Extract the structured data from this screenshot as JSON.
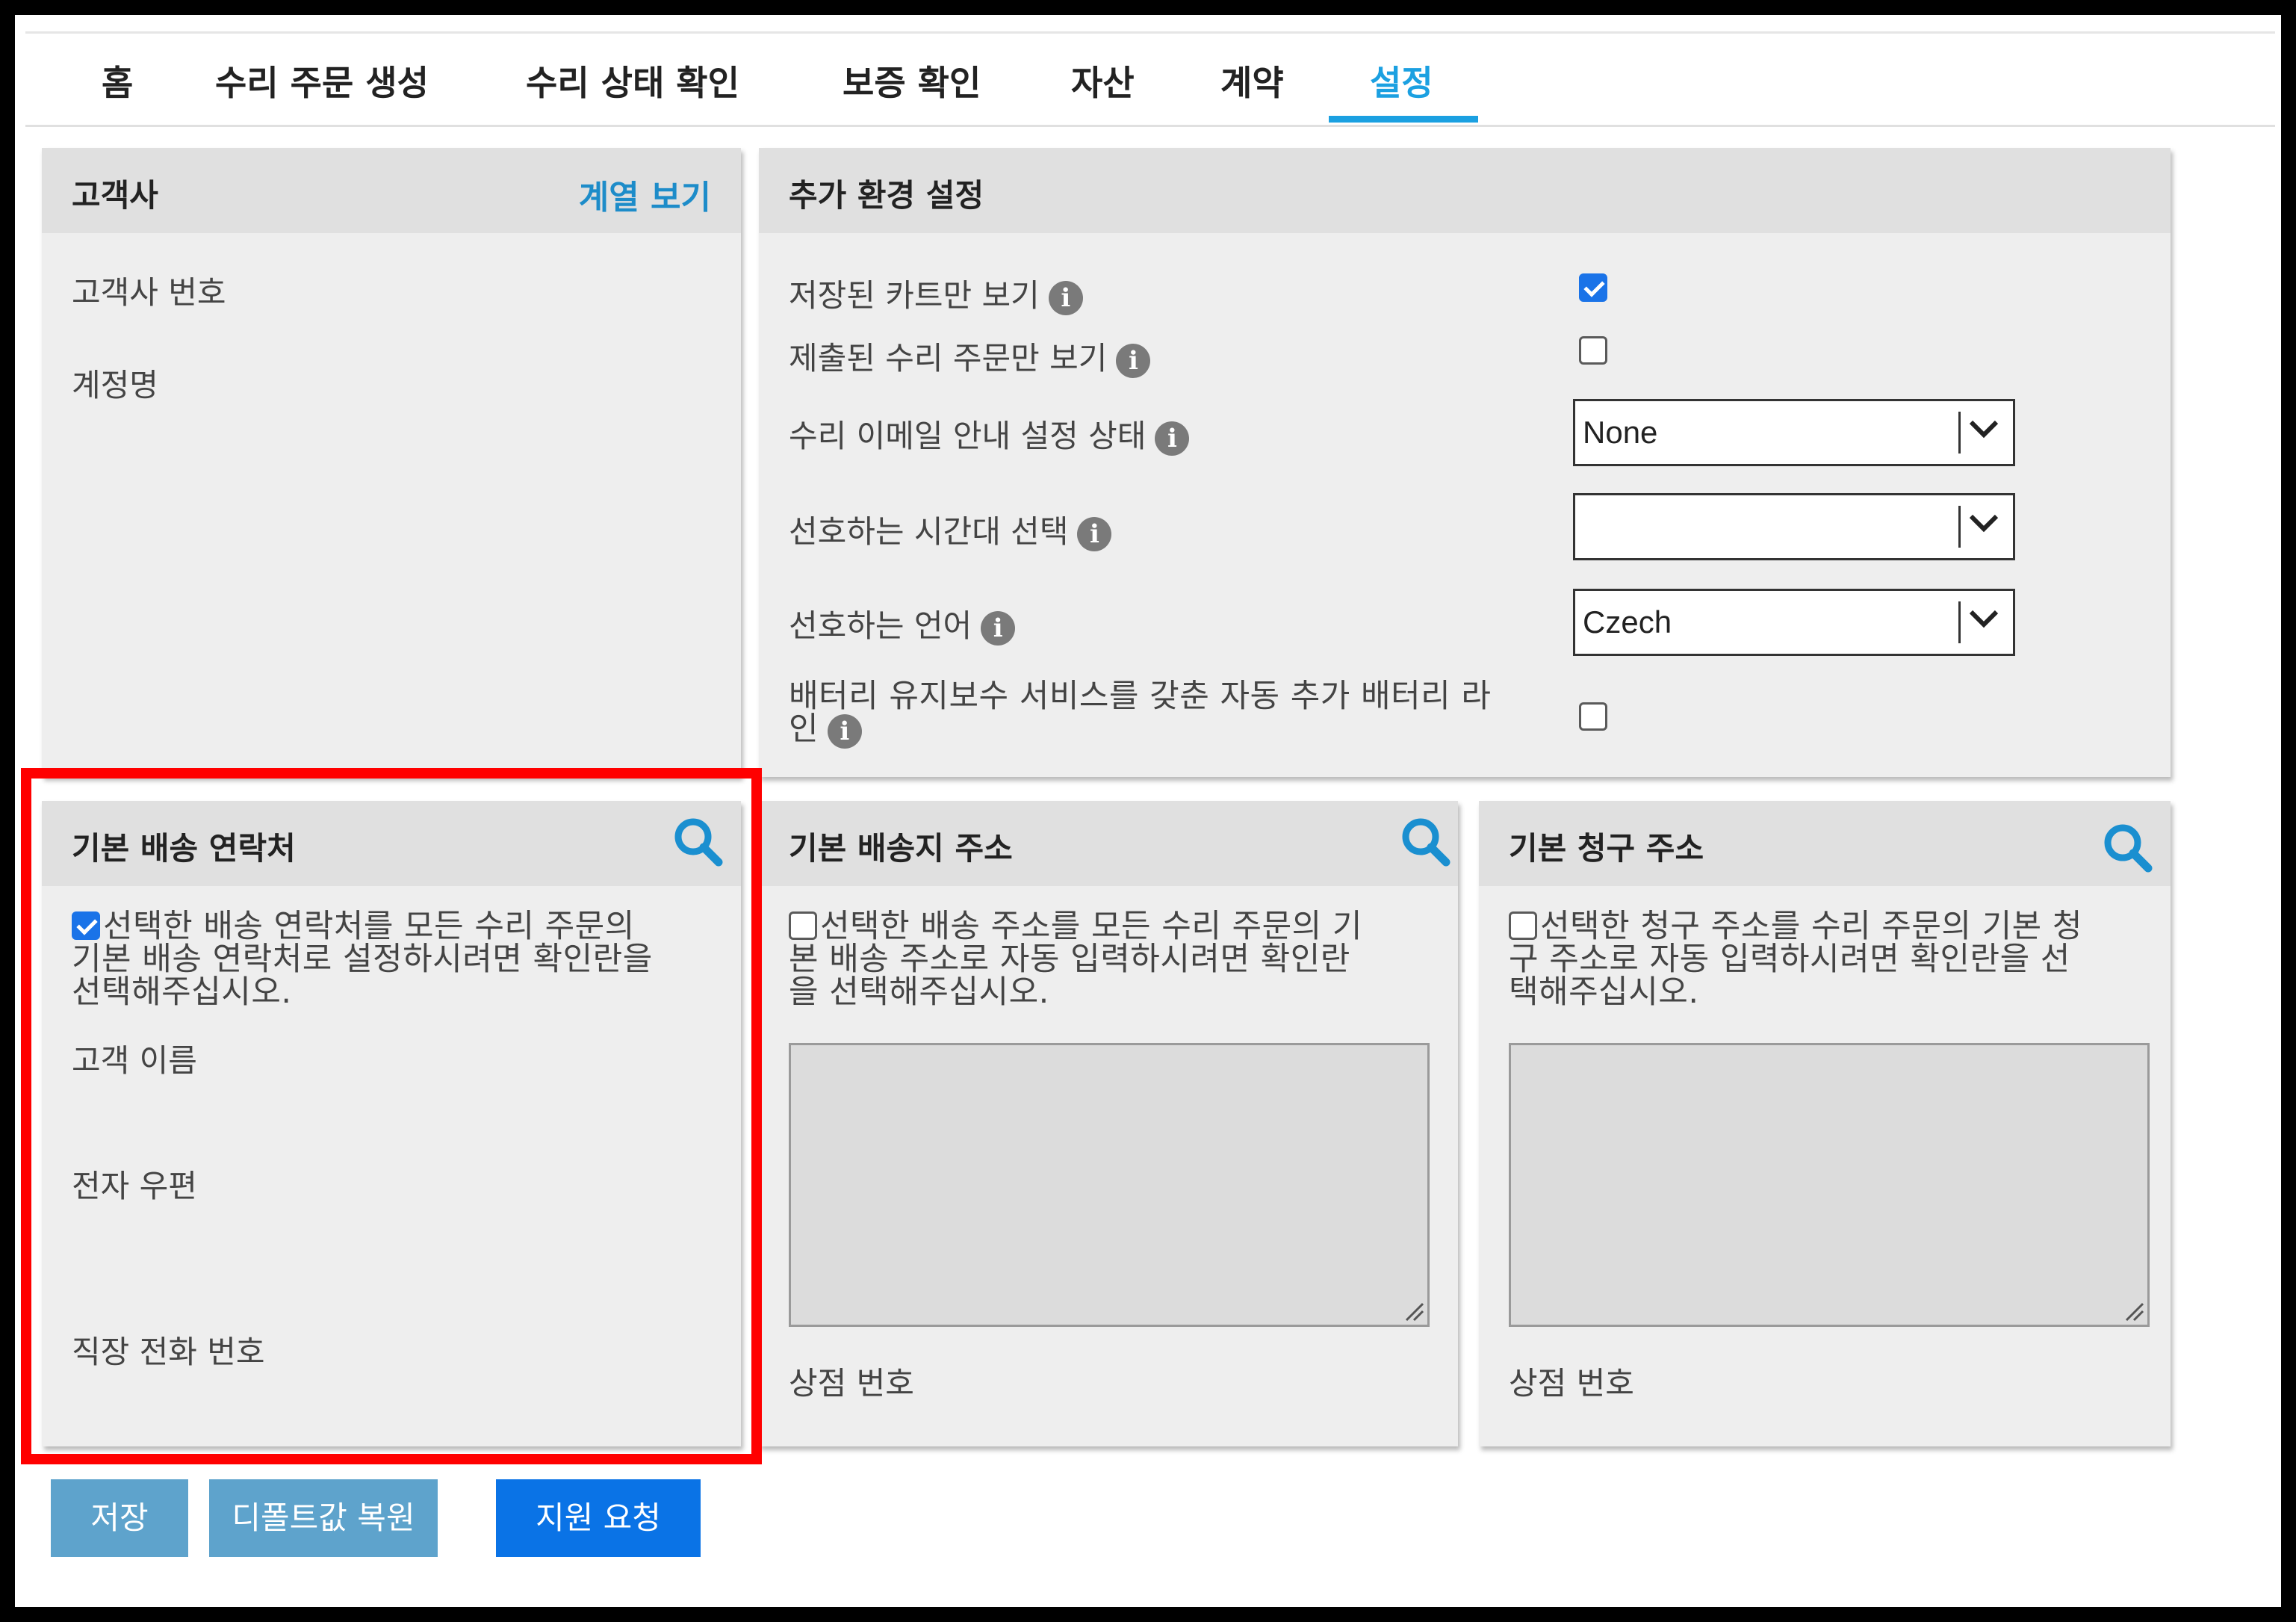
{
  "tabs": [
    {
      "label": "홈"
    },
    {
      "label": "수리 주문 생성"
    },
    {
      "label": "수리 상태 확인"
    },
    {
      "label": "보증 확인"
    },
    {
      "label": "자산"
    },
    {
      "label": "계약"
    },
    {
      "label": "설정",
      "active": true
    }
  ],
  "customer": {
    "title": "고객사",
    "link": "계열 보기",
    "fields": [
      "고객사 번호",
      "계정명"
    ]
  },
  "preferences": {
    "title": "추가 환경 설정",
    "rows": [
      {
        "label": "저장된 카트만 보기",
        "type": "checkbox",
        "checked": true
      },
      {
        "label": "제출된 수리 주문만 보기",
        "type": "checkbox",
        "checked": false
      },
      {
        "label": "수리 이메일 안내 설정 상태",
        "type": "select",
        "value": "None"
      },
      {
        "label": "선호하는 시간대 선택",
        "type": "select",
        "value": ""
      },
      {
        "label": "선호하는 언어",
        "type": "select",
        "value": "Czech"
      },
      {
        "label_line1": "배터리 유지보수 서비스를 갖춘 자동 추가 배터리 라",
        "label_line2": "인",
        "type": "checkbox",
        "checked": false
      }
    ]
  },
  "shipping_contact": {
    "title": "기본 배송 연락처",
    "checkbox_checked": true,
    "checkbox_text_1": "선택한 배송 연락처를 모든 수리 주문의",
    "checkbox_text_2": "기본 배송 연락처로 설정하시려면 확인란을",
    "checkbox_text_3": "선택해주십시오.",
    "fields": [
      "고객 이름",
      "전자 우편",
      "직장 전화 번호"
    ]
  },
  "shipping_address": {
    "title": "기본 배송지 주소",
    "checkbox_checked": false,
    "checkbox_text_1": "선택한 배송 주소를 모든 수리 주문의 기",
    "checkbox_text_2": "본 배송 주소로 자동 입력하시려면 확인란",
    "checkbox_text_3": "을 선택해주십시오.",
    "store_label": "상점 번호"
  },
  "billing_address": {
    "title": "기본 청구 주소",
    "checkbox_checked": false,
    "checkbox_text_1": "선택한 청구 주소를 수리 주문의 기본 청",
    "checkbox_text_2": "구 주소로 자동 입력하시려면 확인란을 선",
    "checkbox_text_3": "택해주십시오.",
    "store_label": "상점 번호"
  },
  "buttons": {
    "save": "저장",
    "restore": "디폴트값 복원",
    "support": "지원 요청"
  },
  "colors": {
    "accent": "#1ba0e1",
    "highlight": "#ff0000",
    "primary_button": "#0a73e6",
    "secondary_button": "#5ea3cc"
  },
  "icons": {
    "info": "info-icon",
    "search": "search-icon",
    "dropdown": "chevron-down-icon"
  }
}
